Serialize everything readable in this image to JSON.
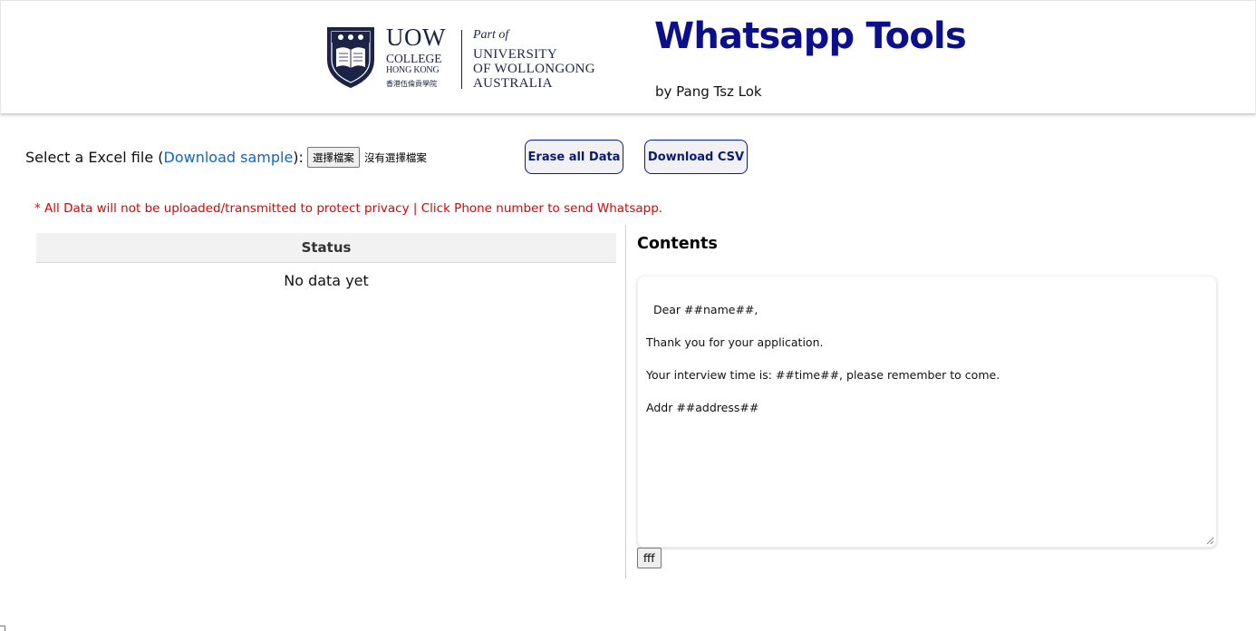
{
  "header": {
    "logo": {
      "name": "UOW",
      "college": "COLLEGE",
      "location": "HONG KONG",
      "chinese": "香港伍倫貢學院",
      "part_of": "Part of",
      "university_lines": [
        "UNIVERSITY",
        "OF WOLLONGONG",
        "AUSTRALIA"
      ]
    },
    "title": "Whatsapp Tools",
    "byline": "by Pang Tsz Lok"
  },
  "toolbar": {
    "select_prefix": "Select a Excel file (",
    "download_sample_link": "Download sample",
    "select_suffix": "):",
    "file_button_label": "選擇檔案",
    "file_status": "沒有選擇檔案",
    "erase_button_label": "Erase all Data",
    "download_csv_button_label": "Download CSV"
  },
  "notice": "* All Data will not be uploaded/transmitted to protect privacy | Click Phone number to send Whatsapp.",
  "status_table": {
    "header": "Status",
    "empty_message": "No data yet"
  },
  "contents": {
    "title": "Contents",
    "template_text": "Dear ##name##,\n\nThank you for your application.\n\nYour interview time is: ##time##, please remember to come.\n\nAddr ##address##",
    "button_label": "fff"
  },
  "colors": {
    "title": "#0b0f8c",
    "link": "#1565c0",
    "notice": "#e10000",
    "button_border": "#0b1c8c",
    "logo_navy": "#1b2346"
  }
}
